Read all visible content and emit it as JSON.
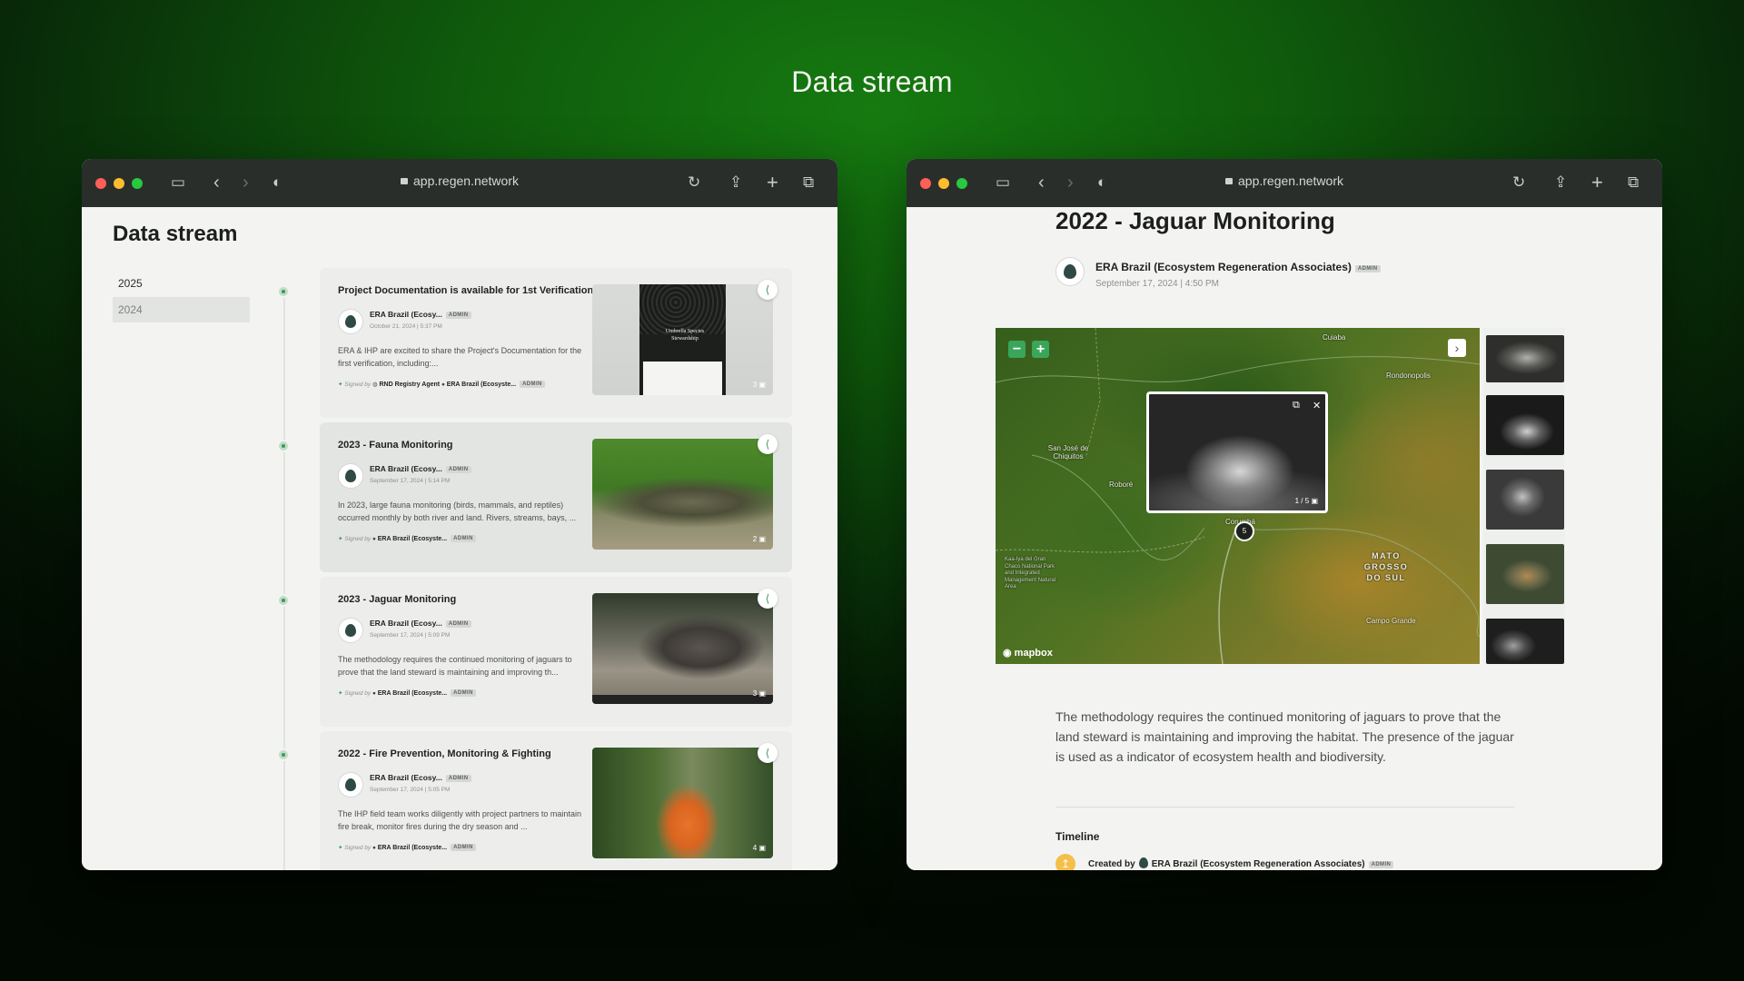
{
  "page": {
    "title": "Data stream"
  },
  "browser": {
    "url": "app.regen.network"
  },
  "left": {
    "heading": "Data stream",
    "years": [
      "2025",
      "2024"
    ],
    "posts": [
      {
        "title": "Project Documentation is available for 1st Verification",
        "author": "ERA Brazil (Ecosy...",
        "badge": "ADMIN",
        "date": "October 21, 2024 | 5:37 PM",
        "desc": "ERA & IHP are excited to share the Project's Documentation for the first verification, including:...",
        "signed_label": "Signed by",
        "signer1": "RND Registry Agent",
        "signer2": "ERA Brazil (Ecosyste...",
        "signer2_badge": "ADMIN",
        "media_count": "3"
      },
      {
        "title": "2023 - Fauna Monitoring",
        "author": "ERA Brazil (Ecosy...",
        "badge": "ADMIN",
        "date": "September 17, 2024 | 5:14 PM",
        "desc": "In 2023, large fauna monitoring (birds, mammals, and reptiles) occurred monthly by both river and land. Rivers, streams, bays, ...",
        "signed_label": "Signed by",
        "signer1": "ERA Brazil (Ecosyste...",
        "signer1_badge": "ADMIN",
        "media_count": "2"
      },
      {
        "title": "2023 - Jaguar Monitoring",
        "author": "ERA Brazil (Ecosy...",
        "badge": "ADMIN",
        "date": "September 17, 2024 | 5:09 PM",
        "desc": "The methodology requires the continued monitoring of jaguars to prove that the land steward is maintaining and improving th...",
        "signed_label": "Signed by",
        "signer1": "ERA Brazil (Ecosyste...",
        "signer1_badge": "ADMIN",
        "media_count": "3"
      },
      {
        "title": "2022 - Fire Prevention, Monitoring & Fighting",
        "author": "ERA Brazil (Ecosy...",
        "badge": "ADMIN",
        "date": "September 17, 2024 | 5:05 PM",
        "desc": "The IHP field team works diligently with project partners to maintain fire break, monitor fires during the dry season and ...",
        "signed_label": "Signed by",
        "signer1": "ERA Brazil (Ecosyste...",
        "signer1_badge": "ADMIN",
        "media_count": "4"
      }
    ],
    "doc_thumb_text": "Umbrella Species Stewardship"
  },
  "right": {
    "title": "2022 - Jaguar Monitoring",
    "author": "ERA Brazil (Ecosystem Regeneration Associates)",
    "badge": "ADMIN",
    "date": "September 17, 2024 | 4:50 PM",
    "map": {
      "labels": [
        "Cuiaba",
        "Rondonopolis",
        "San José de Chiquitos",
        "Roboré",
        "Corumbá",
        "MATO GROSSO DO SUL",
        "Campo Grande",
        "Kaa-Iya del Gran Chaco National Park and Integrated Management Natural Area"
      ],
      "popup_count": "1 / 5",
      "pin_label": "5",
      "attribution": "mapbox"
    },
    "description": "The methodology requires the continued monitoring of jaguars to prove that the land steward is maintaining and improving the habitat. The presence of the jaguar is used as a indicator of ecosystem health and biodiversity.",
    "timeline": {
      "heading": "Timeline",
      "created_by": "Created by",
      "creator": "ERA Brazil (Ecosystem Regeneration Associates)",
      "badge": "ADMIN"
    }
  },
  "icons": [
    "sidebar-icon",
    "back-icon",
    "forward-icon",
    "shield-icon",
    "lock-icon",
    "reload-icon",
    "share-icon",
    "new-tab-icon",
    "tabs-icon",
    "zoom-out-icon",
    "zoom-in-icon",
    "next-icon",
    "external-link-icon",
    "close-icon",
    "image-icon"
  ],
  "colors": {
    "accent": "#3aa65a",
    "background_top": "#167a10",
    "chrome": "#2a2e2b"
  }
}
